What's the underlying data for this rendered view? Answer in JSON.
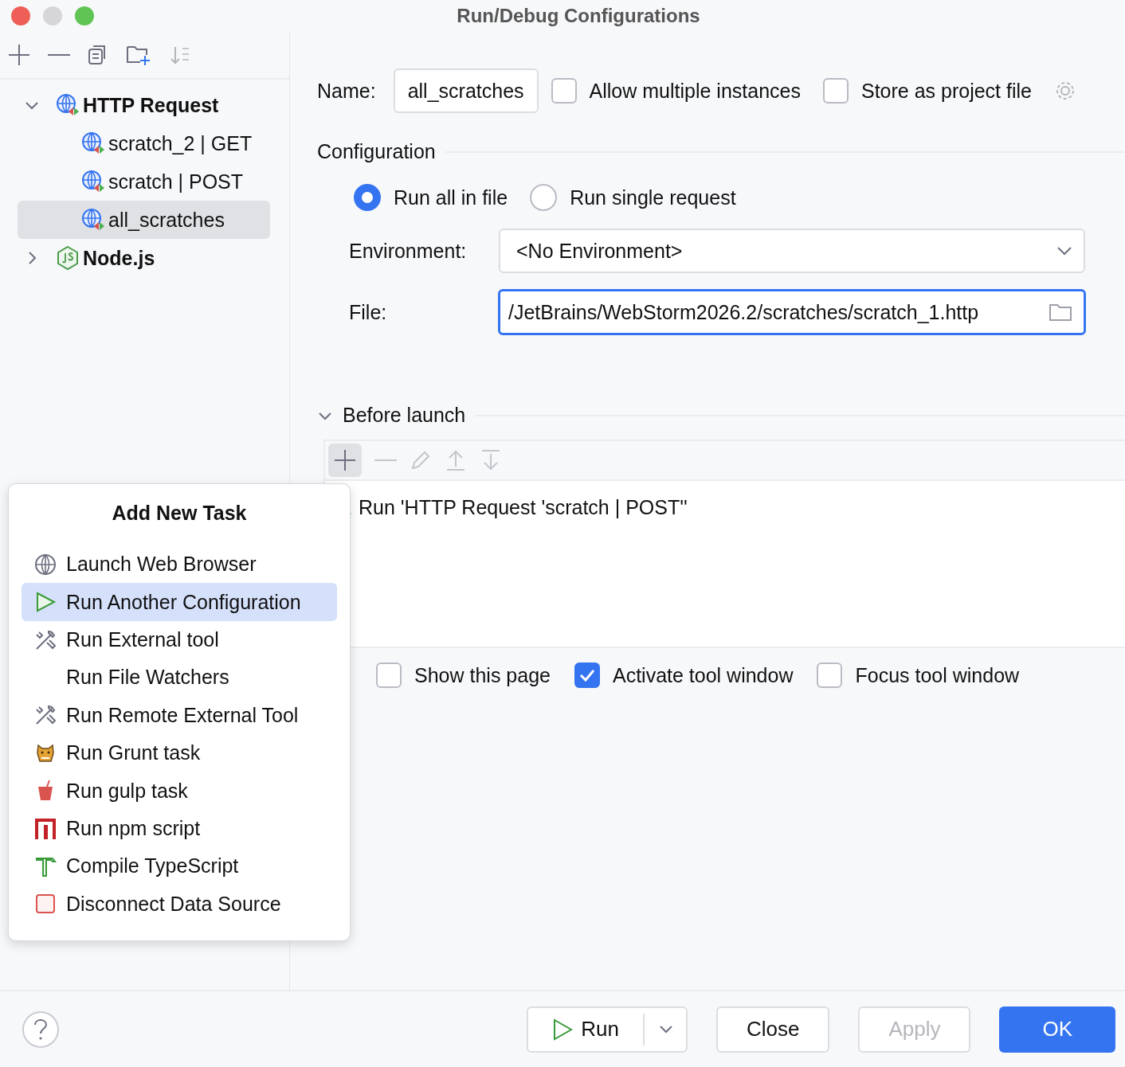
{
  "window": {
    "title": "Run/Debug Configurations"
  },
  "tree": [
    {
      "label": "HTTP Request",
      "kind": "http",
      "expanded": true,
      "selected": false,
      "children": [
        {
          "label": "scratch_2 | GET",
          "kind": "http",
          "selected": false
        },
        {
          "label": "scratch | POST",
          "kind": "http",
          "selected": false
        },
        {
          "label": "all_scratches",
          "kind": "http",
          "selected": true
        }
      ]
    },
    {
      "label": "Node.js",
      "kind": "nodejs",
      "expanded": false,
      "selected": false
    }
  ],
  "name_row": {
    "label": "Name:",
    "value": "all_scratches",
    "options": [
      {
        "label": "Allow multiple instances",
        "checked": false
      },
      {
        "label": "Store as project file",
        "checked": false
      }
    ]
  },
  "configuration": {
    "title": "Configuration",
    "modes": [
      {
        "label": "Run all in file",
        "selected": true
      },
      {
        "label": "Run single request",
        "selected": false
      }
    ],
    "environment": {
      "label": "Environment:",
      "value": "<No Environment>"
    },
    "file": {
      "label": "File:",
      "value": "/JetBrains/WebStorm2026.2/scratches/scratch_1.http"
    }
  },
  "before_launch": {
    "title": "Before launch",
    "expanded": true,
    "tasks": [
      {
        "label": "Run 'HTTP Request 'scratch | POST''"
      }
    ],
    "options": [
      {
        "label": "Show this page",
        "checked": false
      },
      {
        "label": "Activate tool window",
        "checked": true
      },
      {
        "label": "Focus tool window",
        "checked": false
      }
    ]
  },
  "popup": {
    "title": "Add New Task",
    "items": [
      {
        "label": "Launch Web Browser",
        "kind": "globe",
        "selected": false
      },
      {
        "label": "Run Another Configuration",
        "kind": "play",
        "selected": true
      },
      {
        "label": "Run External tool",
        "kind": "tools",
        "selected": false
      },
      {
        "label": "Run File Watchers",
        "kind": "plain",
        "selected": false
      },
      {
        "label": "Run Remote External Tool",
        "kind": "tools",
        "selected": false
      },
      {
        "label": "Run Grunt task",
        "kind": "grunt",
        "selected": false
      },
      {
        "label": "Run gulp task",
        "kind": "gulp",
        "selected": false
      },
      {
        "label": "Run npm script",
        "kind": "npm",
        "selected": false
      },
      {
        "label": "Compile TypeScript",
        "kind": "typescript",
        "selected": false
      },
      {
        "label": "Disconnect Data Source",
        "kind": "datasource",
        "selected": false
      }
    ]
  },
  "buttons": [
    {
      "label": "Run",
      "kind": "split",
      "disabled": false
    },
    {
      "label": "Close",
      "kind": "normal",
      "disabled": false
    },
    {
      "label": "Apply",
      "kind": "normal",
      "disabled": true
    },
    {
      "label": "OK",
      "kind": "primary",
      "disabled": false
    }
  ]
}
